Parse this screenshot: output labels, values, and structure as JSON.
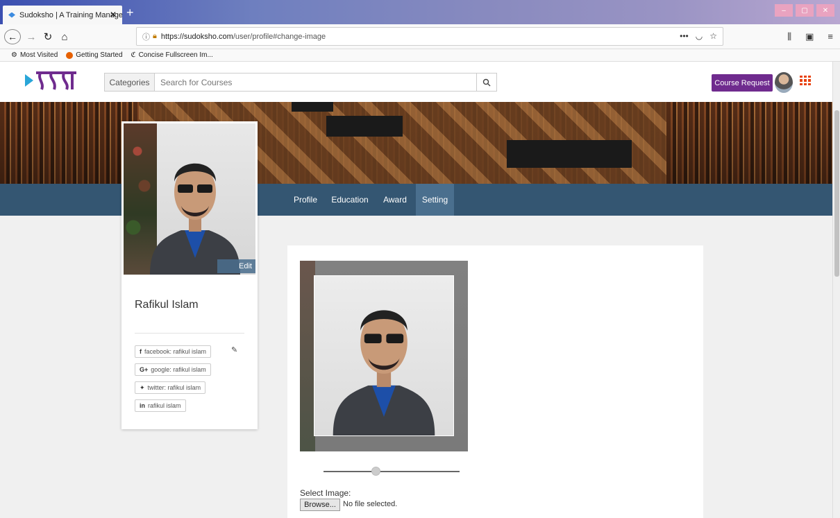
{
  "browser": {
    "tab_title": "Sudoksho | A Training Manage",
    "tab_close": "✕",
    "new_tab": "+",
    "url_host": "https://sudoksho.com",
    "url_path": "/user/profile#change-image",
    "url_more": "•••",
    "win_min": "–",
    "win_max": "▢",
    "win_close": "✕",
    "bookmarks": [
      "Most Visited",
      "Getting Started",
      "Concise Fullscreen Im..."
    ]
  },
  "header": {
    "categories_label": "Categories",
    "search_placeholder": "Search for Courses",
    "course_request_label": "Course Request",
    "brand_color": "#6f2b8e",
    "grid_color": "#e8420f"
  },
  "profile_nav": {
    "items": [
      "Profile",
      "Education",
      "Award",
      "Setting"
    ],
    "active": "Setting",
    "bg_color": "#345672"
  },
  "user": {
    "name": "Rafikul Islam",
    "edit_label": "Edit",
    "social": [
      {
        "icon": "facebook-icon",
        "glyph": "f",
        "label": "facebook: rafikul islam"
      },
      {
        "icon": "google-plus-icon",
        "glyph": "G+",
        "label": "google: rafikul islam"
      },
      {
        "icon": "twitter-icon",
        "glyph": "✦",
        "label": "twitter: rafikul islam"
      },
      {
        "icon": "linkedin-icon",
        "glyph": "in",
        "label": "rafikul islam"
      }
    ]
  },
  "change_image": {
    "select_label": "Select Image:",
    "browse_label": "Browse...",
    "no_file": "No file selected.",
    "zoom_level": 0.5
  }
}
